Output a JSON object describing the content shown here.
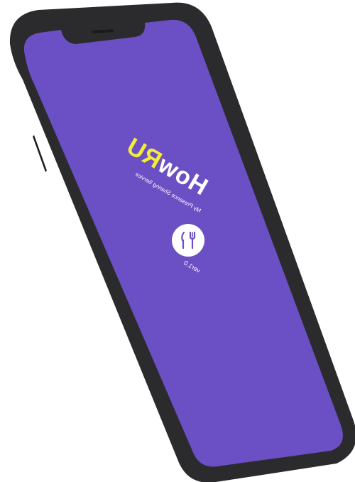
{
  "app": {
    "logo_part_a": "How",
    "logo_part_b": "RU",
    "tagline": "My Presence Sharing Service",
    "version": "ver1.0",
    "icon": "fork-knife-icon"
  },
  "colors": {
    "screen_background": "#6b4fc4",
    "logo_white": "#ffffff",
    "logo_accent": "#f4ec3a",
    "phone_frame": "#2b2b2d"
  }
}
